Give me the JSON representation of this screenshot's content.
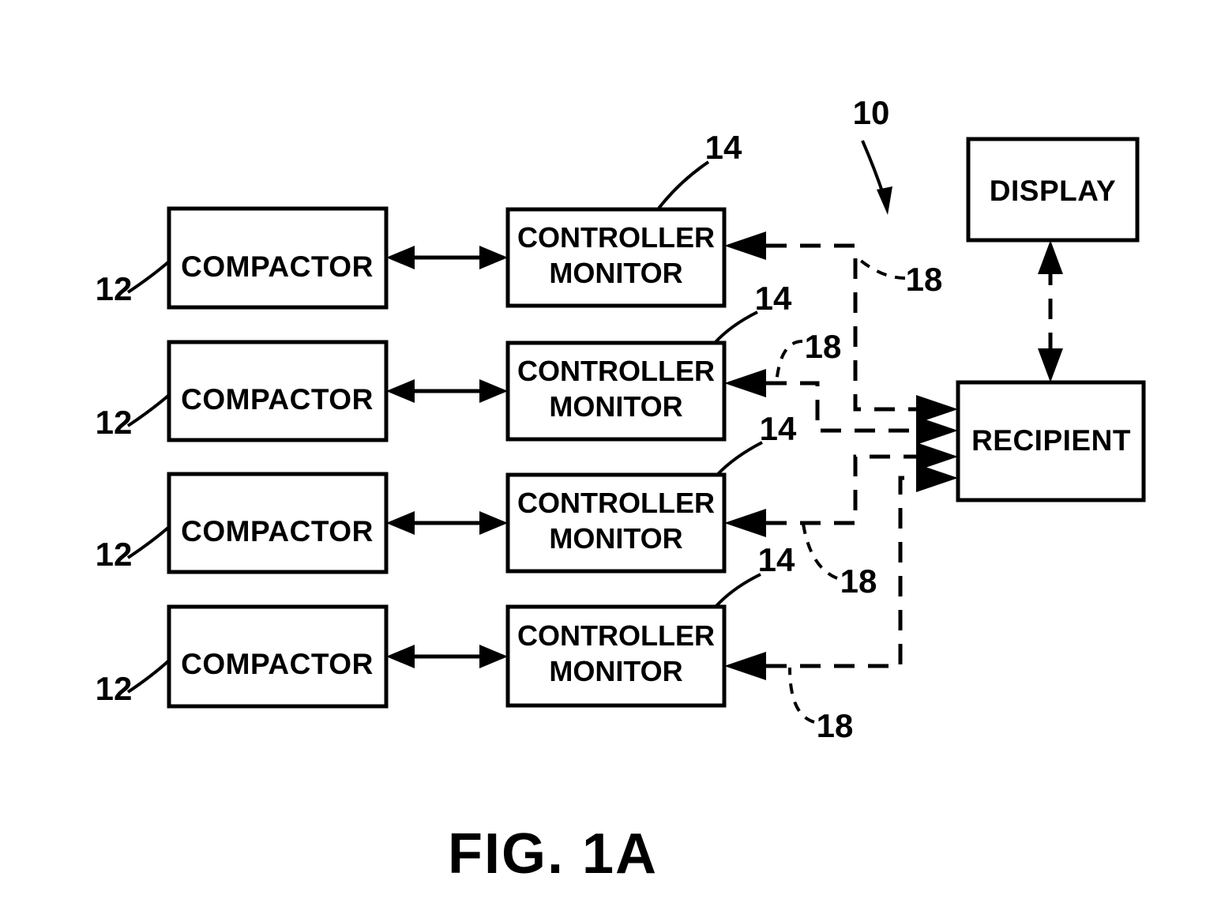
{
  "figure": {
    "caption": "FIG. 1A",
    "system_ref": "10"
  },
  "boxes": {
    "compactors": [
      {
        "label": "COMPACTOR",
        "ref": "12"
      },
      {
        "label": "COMPACTOR",
        "ref": "12"
      },
      {
        "label": "COMPACTOR",
        "ref": "12"
      },
      {
        "label": "COMPACTOR",
        "ref": "12"
      }
    ],
    "controllers": [
      {
        "line1": "CONTROLLER",
        "line2": "MONITOR",
        "ref": "14"
      },
      {
        "line1": "CONTROLLER",
        "line2": "MONITOR",
        "ref": "14"
      },
      {
        "line1": "CONTROLLER",
        "line2": "MONITOR",
        "ref": "14"
      },
      {
        "line1": "CONTROLLER",
        "line2": "MONITOR",
        "ref": "14"
      }
    ],
    "display": {
      "label": "DISPLAY"
    },
    "recipient": {
      "label": "RECIPIENT"
    }
  },
  "links": {
    "communication_refs": [
      "18",
      "18",
      "18",
      "18"
    ]
  },
  "colors": {
    "ink": "#000000",
    "paper": "#ffffff"
  }
}
